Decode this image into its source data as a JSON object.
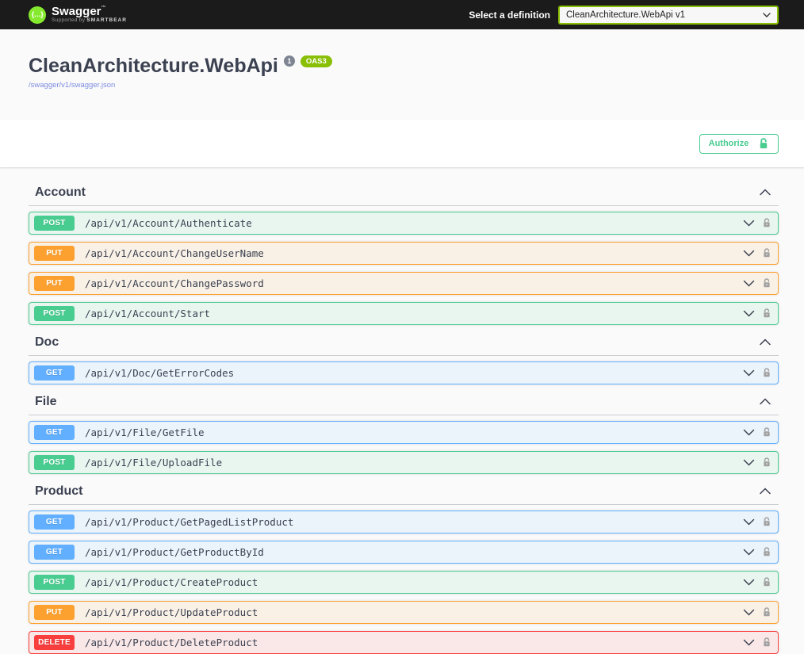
{
  "topbar": {
    "brand": "Swagger",
    "brand_tm": "™",
    "supported_by": "Supported by",
    "supporter": "SMARTBEAR",
    "logo_glyph": "{…}",
    "select_label": "Select a definition",
    "selected_definition": "CleanArchitecture.WebApi v1"
  },
  "info": {
    "title": "CleanArchitecture.WebApi",
    "version_badge": "1",
    "oas_badge": "OAS3",
    "spec_url": "/swagger/v1/swagger.json"
  },
  "auth": {
    "authorize_label": "Authorize"
  },
  "colors": {
    "topbar_bg": "#1b1b1b",
    "page_bg": "#fafafa",
    "brand_green": "#85ea2d",
    "oas_green": "#89bf04",
    "authorize_green": "#49cc90",
    "heading_text": "#3b4151",
    "methods": {
      "GET": "#61affe",
      "POST": "#49cc90",
      "PUT": "#fca130",
      "DELETE": "#f93e3e"
    }
  },
  "sections": [
    {
      "name": "Account",
      "expanded": true,
      "operations": [
        {
          "method": "POST",
          "path": "/api/v1/Account/Authenticate"
        },
        {
          "method": "PUT",
          "path": "/api/v1/Account/ChangeUserName"
        },
        {
          "method": "PUT",
          "path": "/api/v1/Account/ChangePassword"
        },
        {
          "method": "POST",
          "path": "/api/v1/Account/Start"
        }
      ]
    },
    {
      "name": "Doc",
      "expanded": true,
      "operations": [
        {
          "method": "GET",
          "path": "/api/v1/Doc/GetErrorCodes"
        }
      ]
    },
    {
      "name": "File",
      "expanded": true,
      "operations": [
        {
          "method": "GET",
          "path": "/api/v1/File/GetFile"
        },
        {
          "method": "POST",
          "path": "/api/v1/File/UploadFile"
        }
      ]
    },
    {
      "name": "Product",
      "expanded": true,
      "operations": [
        {
          "method": "GET",
          "path": "/api/v1/Product/GetPagedListProduct"
        },
        {
          "method": "GET",
          "path": "/api/v1/Product/GetProductById"
        },
        {
          "method": "POST",
          "path": "/api/v1/Product/CreateProduct"
        },
        {
          "method": "PUT",
          "path": "/api/v1/Product/UpdateProduct"
        },
        {
          "method": "DELETE",
          "path": "/api/v1/Product/DeleteProduct"
        }
      ]
    }
  ]
}
